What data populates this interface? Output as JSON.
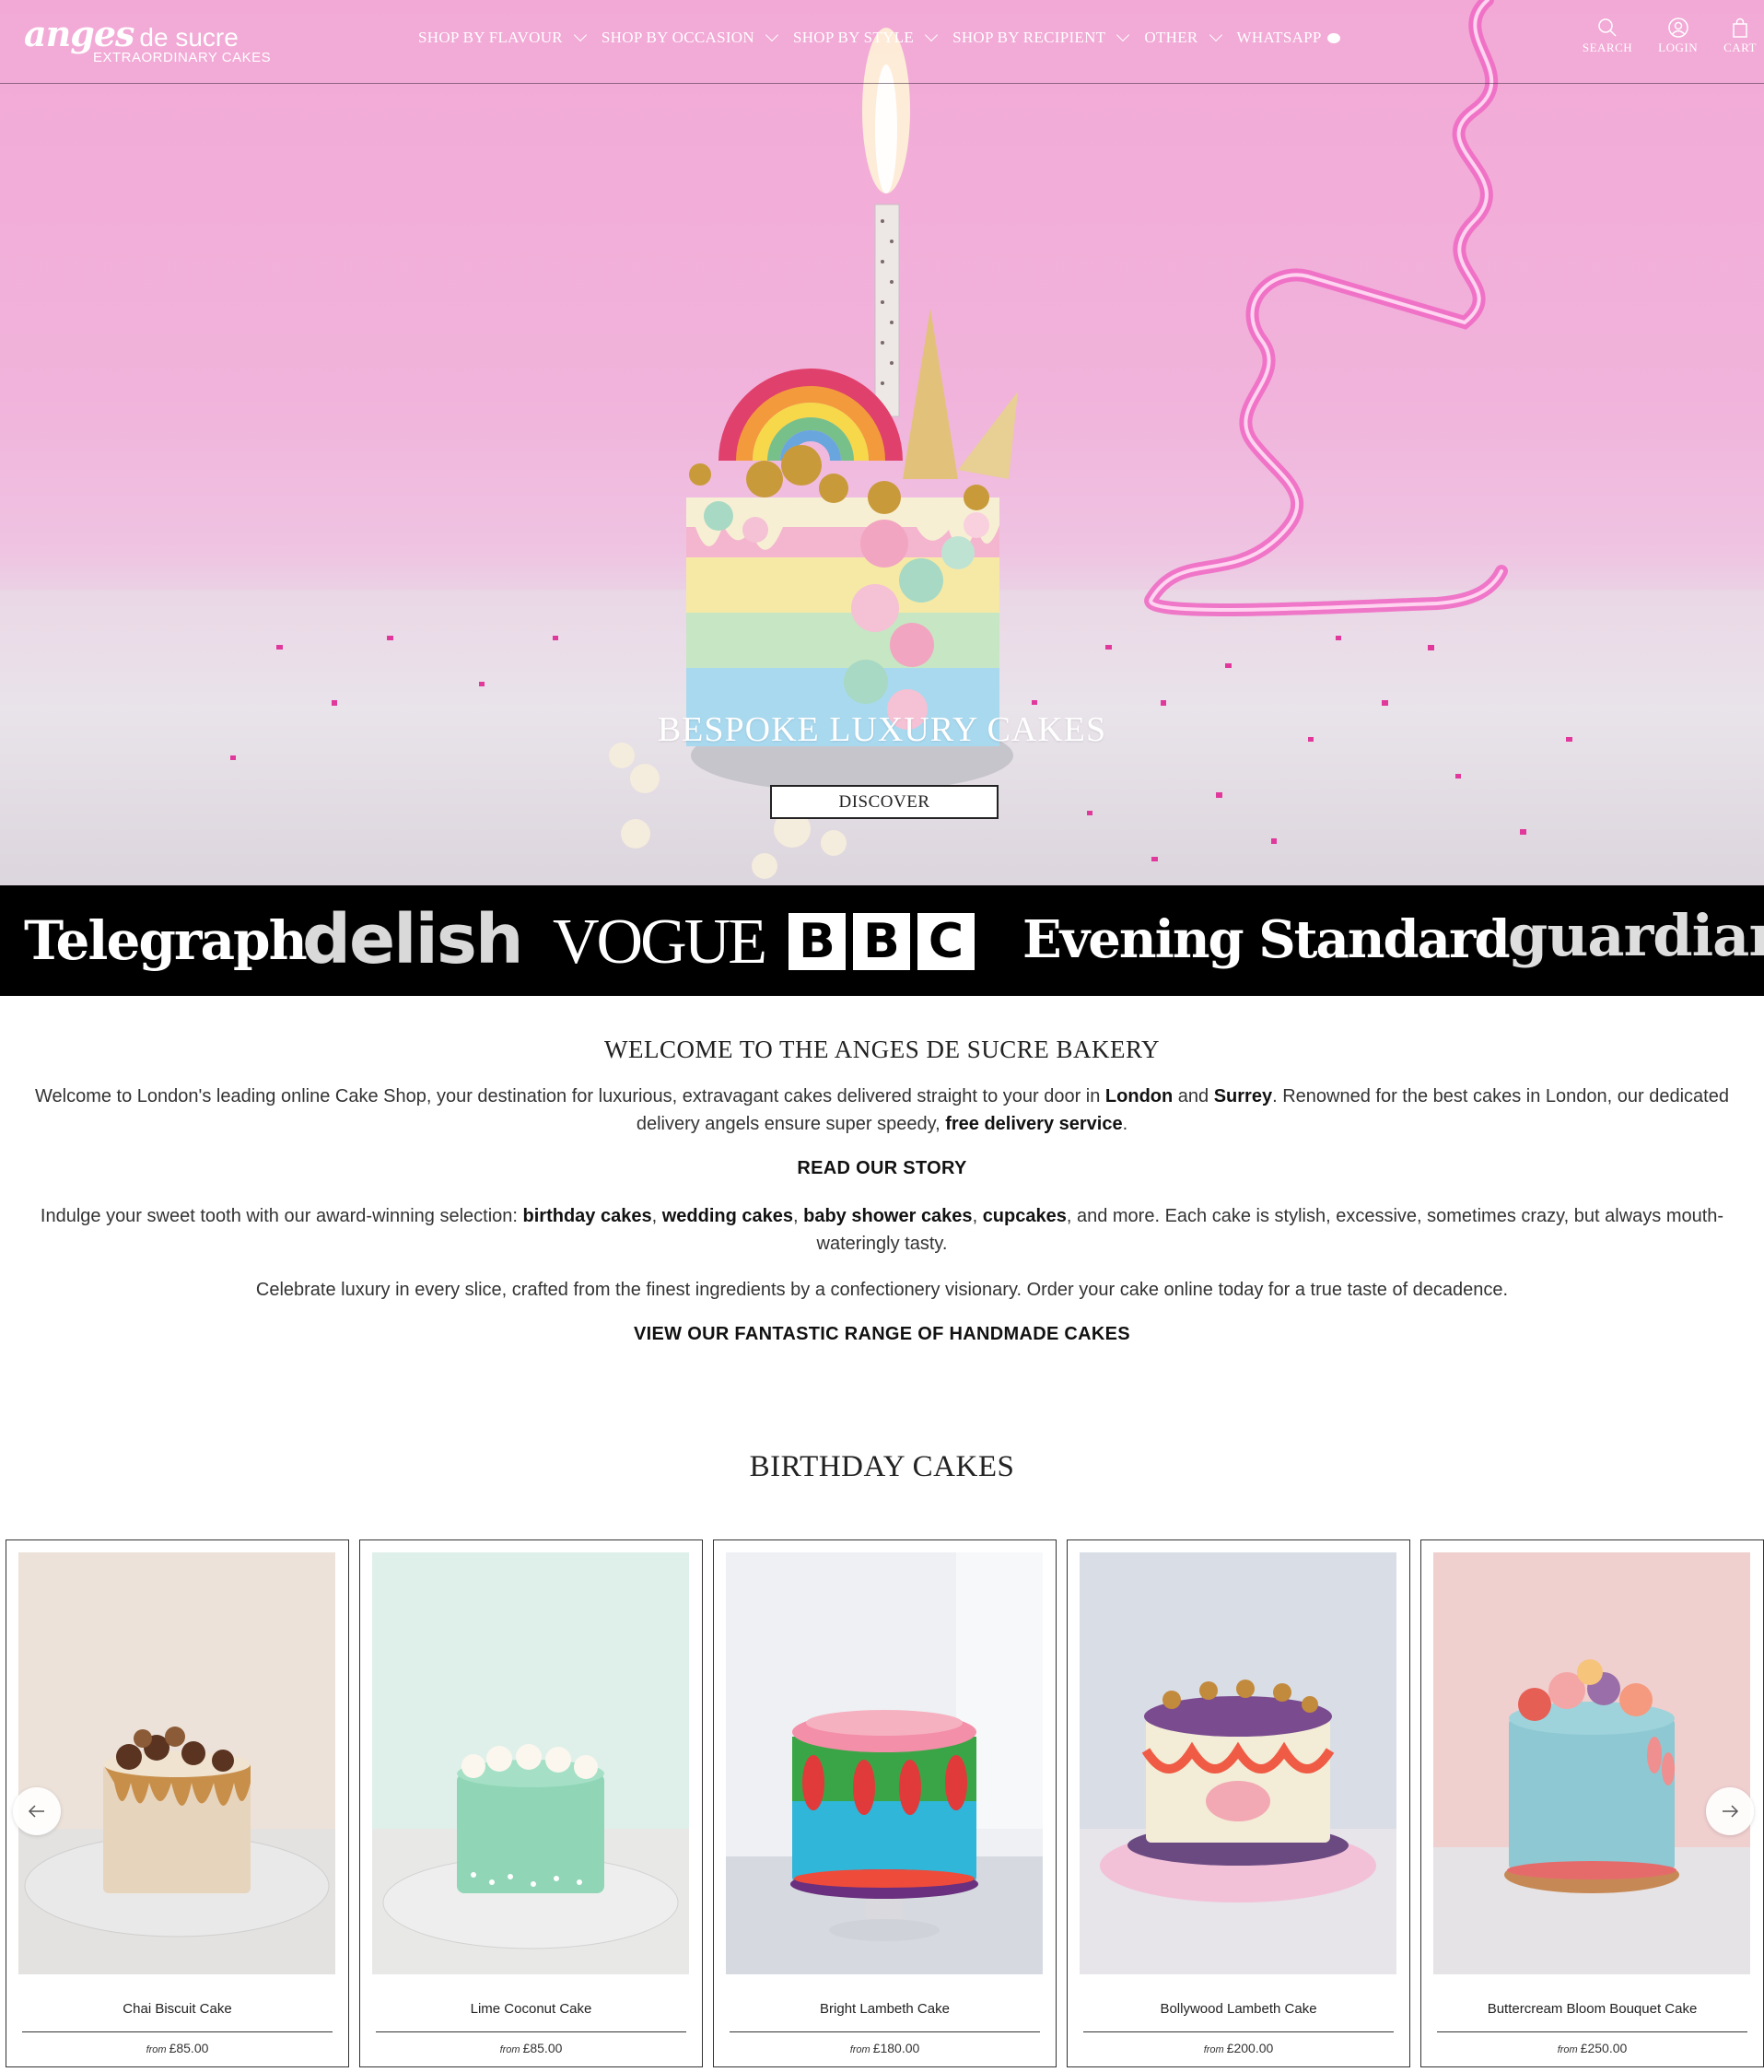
{
  "header": {
    "logo_script": "anges",
    "logo_word": "de sucre",
    "logo_tagline": "EXTRAORDINARY CAKES",
    "nav": [
      {
        "label": "SHOP BY FLAVOUR",
        "has_dropdown": true
      },
      {
        "label": "SHOP BY OCCASION",
        "has_dropdown": true
      },
      {
        "label": "SHOP BY STYLE",
        "has_dropdown": true
      },
      {
        "label": "SHOP BY RECIPIENT",
        "has_dropdown": true
      },
      {
        "label": "OTHER",
        "has_dropdown": true
      },
      {
        "label": "WHATSAPP",
        "has_dropdown": false
      }
    ],
    "tools": {
      "search": "SEARCH",
      "login": "LOGIN",
      "cart": "CART"
    }
  },
  "hero": {
    "title": "BESPOKE LUXURY CAKES",
    "button": "DISCOVER"
  },
  "press": [
    "Telegraph",
    "delish",
    "VOGUE",
    "BBC",
    "Evening Standard",
    "guardian"
  ],
  "welcome": {
    "title": "WELCOME TO THE ANGES DE SUCRE BAKERY",
    "p1_a": "Welcome to London's leading online Cake Shop, your destination for luxurious, extravagant cakes delivered straight to your door in ",
    "p1_london": "London",
    "p1_and": " and ",
    "p1_surrey": "Surrey",
    "p1_b": ". Renowned for the best cakes in London, our dedicated delivery angels ensure super speedy, ",
    "p1_free": "free delivery service",
    "p1_end": ".",
    "read_story": "READ OUR STORY",
    "p2_a": "Indulge your sweet tooth with our award-winning selection: ",
    "p2_birthday": "birthday cakes",
    "p2_comma1": ", ",
    "p2_wedding": "wedding cakes",
    "p2_comma2": ", ",
    "p2_baby": "baby shower cakes",
    "p2_comma3": ", ",
    "p2_cupcakes": "cupcakes",
    "p2_b": ", and more. Each cake is stylish, excessive, sometimes crazy, but always mouth-wateringly tasty.",
    "p3": "Celebrate luxury in every slice, crafted from the finest ingredients by a confectionery visionary. Order your cake online today for a true taste of decadence.",
    "view_range": "VIEW OUR FANTASTIC RANGE OF HANDMADE CAKES"
  },
  "birthday": {
    "title": "BIRTHDAY CAKES",
    "products": [
      {
        "name": "Chai Biscuit Cake",
        "from": "from",
        "price": "£85.00"
      },
      {
        "name": "Lime Coconut Cake",
        "from": "from",
        "price": "£85.00"
      },
      {
        "name": "Bright Lambeth Cake",
        "from": "from",
        "price": "£180.00"
      },
      {
        "name": "Bollywood Lambeth Cake",
        "from": "from",
        "price": "£200.00"
      },
      {
        "name": "Buttercream Bloom Bouquet Cake",
        "from": "from",
        "price": "£250.00"
      }
    ]
  },
  "colors": {
    "accent": "#000000",
    "hero_pink": "#f2a9d6",
    "neon": "#f06bc4"
  }
}
